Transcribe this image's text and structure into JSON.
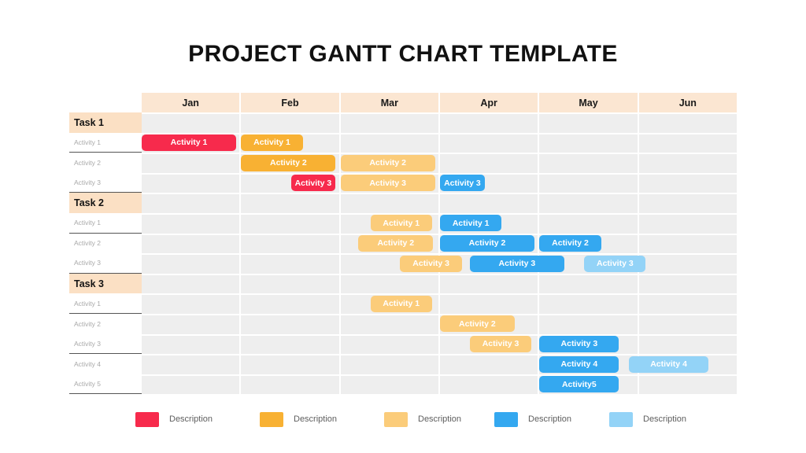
{
  "title": "PROJECT GANTT CHART TEMPLATE",
  "colors": {
    "red": "#F72A4C",
    "orange": "#F8B133",
    "light_orange": "#FBCC7A",
    "blue": "#34A8F0",
    "light_blue": "#93D3F7",
    "header_band": "#fbe6d2",
    "task_band": "#fbe0c4",
    "grid_cell": "#eeeeee"
  },
  "columns": [
    {
      "label": "Jan"
    },
    {
      "label": "Feb"
    },
    {
      "label": "Mar"
    },
    {
      "label": "Apr"
    },
    {
      "label": "May"
    },
    {
      "label": "Jun"
    }
  ],
  "groups": [
    {
      "label": "Task 1",
      "rows": [
        {
          "label": "Activity 1",
          "bars": [
            {
              "text": "Activity 1",
              "color": "#F72A4C",
              "start": 0.0,
              "span": 0.95
            },
            {
              "text": "Activity 1",
              "color": "#F8B133",
              "start": 1.0,
              "span": 0.62
            }
          ]
        },
        {
          "label": "Activity 2",
          "bars": [
            {
              "text": "Activity 2",
              "color": "#F8B133",
              "start": 1.0,
              "span": 0.95
            },
            {
              "text": "Activity 2",
              "color": "#FBCC7A",
              "start": 2.0,
              "span": 0.95
            }
          ]
        },
        {
          "label": "Activity 3",
          "bars": [
            {
              "text": "Activity 3",
              "color": "#F72A4C",
              "start": 1.5,
              "span": 0.45
            },
            {
              "text": "Activity 3",
              "color": "#FBCC7A",
              "start": 2.0,
              "span": 0.95
            },
            {
              "text": "Activity 3",
              "color": "#34A8F0",
              "start": 3.0,
              "span": 0.45
            }
          ]
        }
      ]
    },
    {
      "label": "Task 2",
      "rows": [
        {
          "label": "Activity 1",
          "bars": [
            {
              "text": "Activity 1",
              "color": "#FBCC7A",
              "start": 2.3,
              "span": 0.62
            },
            {
              "text": "Activity 1",
              "color": "#34A8F0",
              "start": 3.0,
              "span": 0.62
            }
          ]
        },
        {
          "label": "Activity 2",
          "bars": [
            {
              "text": "Activity 2",
              "color": "#FBCC7A",
              "start": 2.18,
              "span": 0.75
            },
            {
              "text": "Activity 2",
              "color": "#34A8F0",
              "start": 3.0,
              "span": 0.95
            },
            {
              "text": "Activity 2",
              "color": "#34A8F0",
              "start": 4.0,
              "span": 0.62
            }
          ]
        },
        {
          "label": "Activity 3",
          "bars": [
            {
              "text": "Activity 3",
              "color": "#FBCC7A",
              "start": 2.6,
              "span": 0.62
            },
            {
              "text": "Activity 3",
              "color": "#34A8F0",
              "start": 3.3,
              "span": 0.95
            },
            {
              "text": "Activity 3",
              "color": "#93D3F7",
              "start": 4.45,
              "span": 0.62
            }
          ]
        }
      ]
    },
    {
      "label": "Task 3",
      "rows": [
        {
          "label": "Activity 1",
          "bars": [
            {
              "text": "Activity 1",
              "color": "#FBCC7A",
              "start": 2.3,
              "span": 0.62
            }
          ]
        },
        {
          "label": "Activity 2",
          "bars": [
            {
              "text": "Activity 2",
              "color": "#FBCC7A",
              "start": 3.0,
              "span": 0.75
            }
          ]
        },
        {
          "label": "Activity 3",
          "bars": [
            {
              "text": "Activity 3",
              "color": "#FBCC7A",
              "start": 3.3,
              "span": 0.62
            },
            {
              "text": "Activity 3",
              "color": "#34A8F0",
              "start": 4.0,
              "span": 0.8
            }
          ]
        },
        {
          "label": "Activity 4",
          "bars": [
            {
              "text": "Activity 4",
              "color": "#34A8F0",
              "start": 4.0,
              "span": 0.8
            },
            {
              "text": "Activity 4",
              "color": "#93D3F7",
              "start": 4.9,
              "span": 0.8
            }
          ]
        },
        {
          "label": "Activity 5",
          "bars": [
            {
              "text": "Activity5",
              "color": "#34A8F0",
              "start": 4.0,
              "span": 0.8
            }
          ]
        }
      ]
    }
  ],
  "legend": [
    {
      "color": "#F72A4C",
      "label": "Description"
    },
    {
      "color": "#F8B133",
      "label": "Description"
    },
    {
      "color": "#FBCC7A",
      "label": "Description"
    },
    {
      "color": "#34A8F0",
      "label": "Description"
    },
    {
      "color": "#93D3F7",
      "label": "Description"
    }
  ],
  "chart_data": {
    "type": "bar",
    "title": "PROJECT GANTT CHART TEMPLATE",
    "xlabel": "",
    "ylabel": "",
    "categories": [
      "Jan",
      "Feb",
      "Mar",
      "Apr",
      "May",
      "Jun"
    ],
    "grid": true,
    "legend_position": "bottom",
    "series": [
      {
        "name": "Task 1 / Activity 1",
        "values": [
          "Jan",
          "Feb"
        ]
      },
      {
        "name": "Task 1 / Activity 2",
        "values": [
          "Feb",
          "Mar"
        ]
      },
      {
        "name": "Task 1 / Activity 3",
        "values": [
          "Feb",
          "Mar",
          "Apr"
        ]
      },
      {
        "name": "Task 2 / Activity 1",
        "values": [
          "Mar",
          "Apr"
        ]
      },
      {
        "name": "Task 2 / Activity 2",
        "values": [
          "Mar",
          "Apr",
          "May"
        ]
      },
      {
        "name": "Task 2 / Activity 3",
        "values": [
          "Mar",
          "Apr",
          "May"
        ]
      },
      {
        "name": "Task 3 / Activity 1",
        "values": [
          "Mar"
        ]
      },
      {
        "name": "Task 3 / Activity 2",
        "values": [
          "Apr"
        ]
      },
      {
        "name": "Task 3 / Activity 3",
        "values": [
          "Apr",
          "May"
        ]
      },
      {
        "name": "Task 3 / Activity 4",
        "values": [
          "May",
          "Jun"
        ]
      },
      {
        "name": "Task 3 / Activity 5",
        "values": [
          "May"
        ]
      }
    ]
  }
}
